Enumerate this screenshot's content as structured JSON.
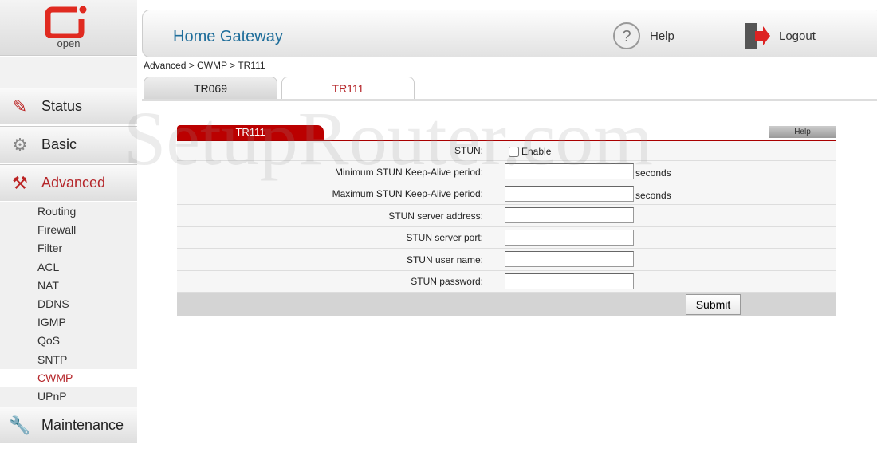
{
  "brand": {
    "logo_text": "open",
    "color": "#e02a20"
  },
  "watermark": "SetupRouter.com",
  "header": {
    "title": "Home Gateway",
    "help": "Help",
    "logout": "Logout"
  },
  "breadcrumb": "Advanced > CWMP > TR111",
  "tabs": [
    {
      "label": "TR069",
      "active": false
    },
    {
      "label": "TR111",
      "active": true
    }
  ],
  "sidebar": {
    "categories": [
      {
        "label": "Status",
        "icon": "monitor-info-icon"
      },
      {
        "label": "Basic",
        "icon": "gear-icon"
      },
      {
        "label": "Advanced",
        "icon": "tools-icon",
        "active": true
      },
      {
        "label": "Maintenance",
        "icon": "wrench-icon"
      }
    ],
    "advanced_items": [
      "Routing",
      "Firewall",
      "Filter",
      "ACL",
      "NAT",
      "DDNS",
      "IGMP",
      "QoS",
      "SNTP",
      "CWMP",
      "UPnP"
    ],
    "active_item": "CWMP"
  },
  "panel": {
    "title": "TR111",
    "help": "Help",
    "stun_label": "STUN:",
    "enable_label": "Enable",
    "enabled": false,
    "fields": [
      {
        "label": "Minimum STUN Keep-Alive period:",
        "value": "",
        "unit": "seconds"
      },
      {
        "label": "Maximum STUN Keep-Alive period:",
        "value": "",
        "unit": "seconds"
      },
      {
        "label": "STUN server address:",
        "value": ""
      },
      {
        "label": "STUN server port:",
        "value": ""
      },
      {
        "label": "STUN user name:",
        "value": ""
      },
      {
        "label": "STUN password:",
        "value": ""
      }
    ],
    "submit": "Submit"
  },
  "colors": {
    "accent": "#b00000",
    "title": "#1e6d9a"
  }
}
